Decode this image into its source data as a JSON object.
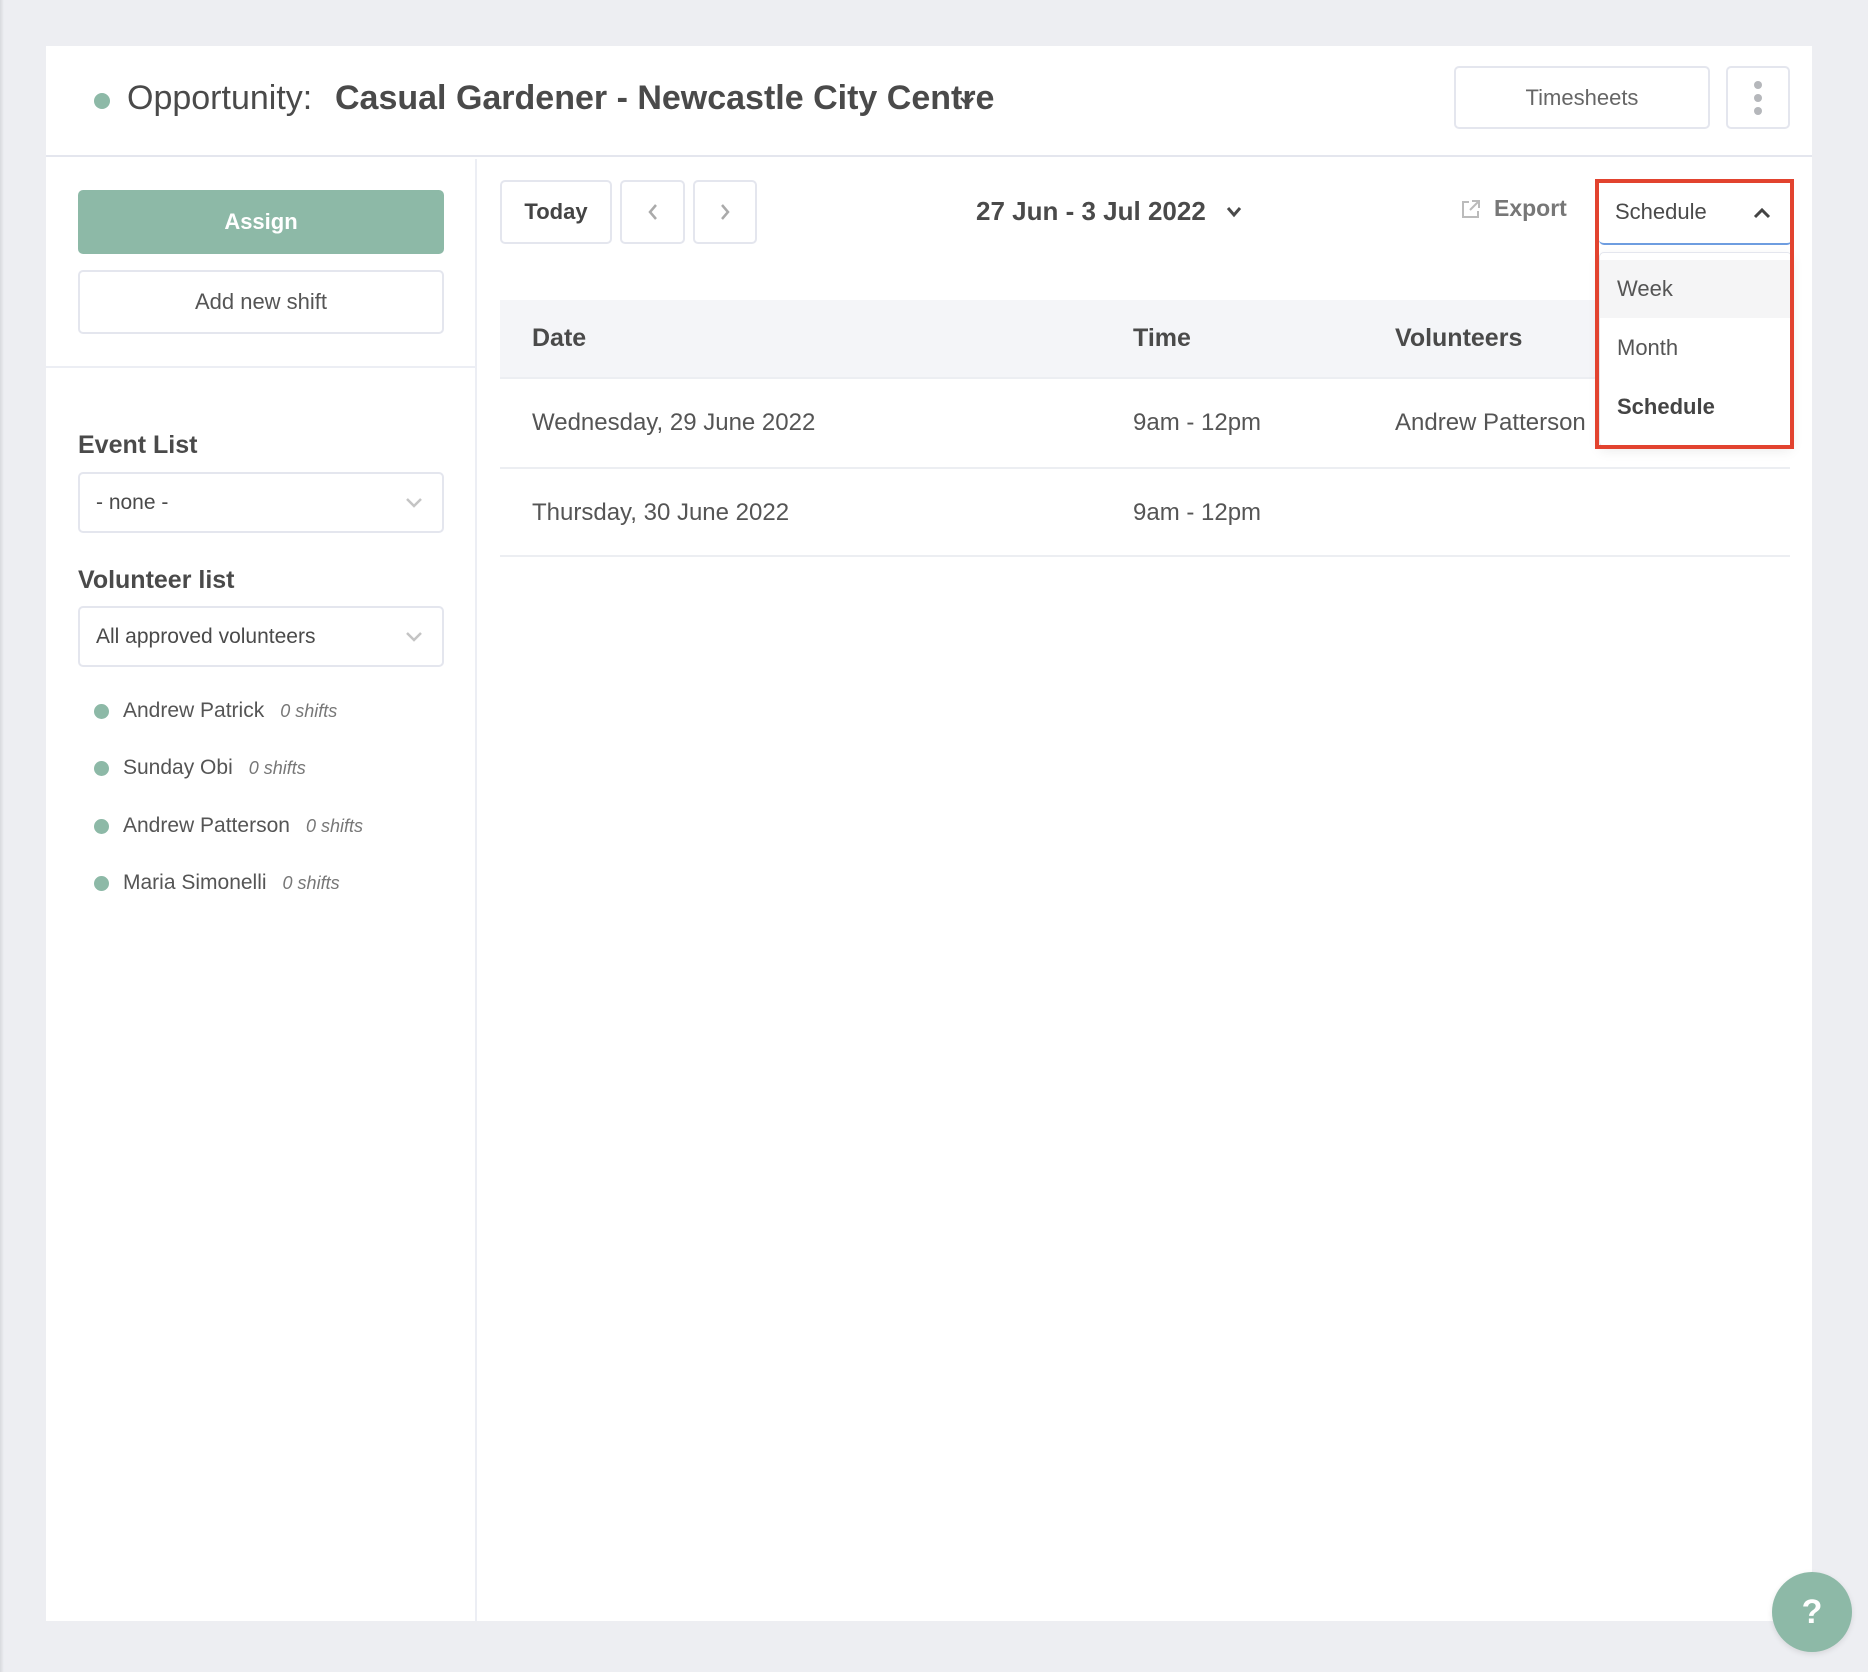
{
  "header": {
    "title_label": "Opportunity:",
    "opportunity_name": "Casual Gardener - Newcastle City Centre",
    "timesheets_label": "Timesheets",
    "status_color": "#8db9a7"
  },
  "sidebar": {
    "assign_label": "Assign",
    "add_shift_label": "Add new shift",
    "event_list": {
      "label": "Event List",
      "selected": "- none -"
    },
    "volunteer_list": {
      "label": "Volunteer list",
      "selected": "All approved volunteers",
      "volunteers": [
        {
          "name": "Andrew Patrick",
          "shifts": "0 shifts"
        },
        {
          "name": "Sunday Obi",
          "shifts": "0 shifts"
        },
        {
          "name": "Andrew Patterson",
          "shifts": "0 shifts"
        },
        {
          "name": "Maria Simonelli",
          "shifts": "0 shifts"
        }
      ]
    }
  },
  "toolbar": {
    "today_label": "Today",
    "date_range": "27 Jun - 3 Jul 2022",
    "export_label": "Export",
    "view_select": {
      "selected": "Schedule",
      "options": [
        "Week",
        "Month",
        "Schedule"
      ],
      "hovered": "Week"
    }
  },
  "table": {
    "columns": [
      "Date",
      "Time",
      "Volunteers"
    ],
    "rows": [
      {
        "date": "Wednesday, 29 June 2022",
        "time": "9am - 12pm",
        "volunteers": "Andrew Patterson"
      },
      {
        "date": "Thursday, 30 June 2022",
        "time": "9am - 12pm",
        "volunteers": ""
      }
    ]
  },
  "help": {
    "label": "?"
  },
  "colors": {
    "accent": "#8db9a7",
    "highlight": "#e2432f",
    "focus": "#6e9de0",
    "background": "#edeef2"
  }
}
